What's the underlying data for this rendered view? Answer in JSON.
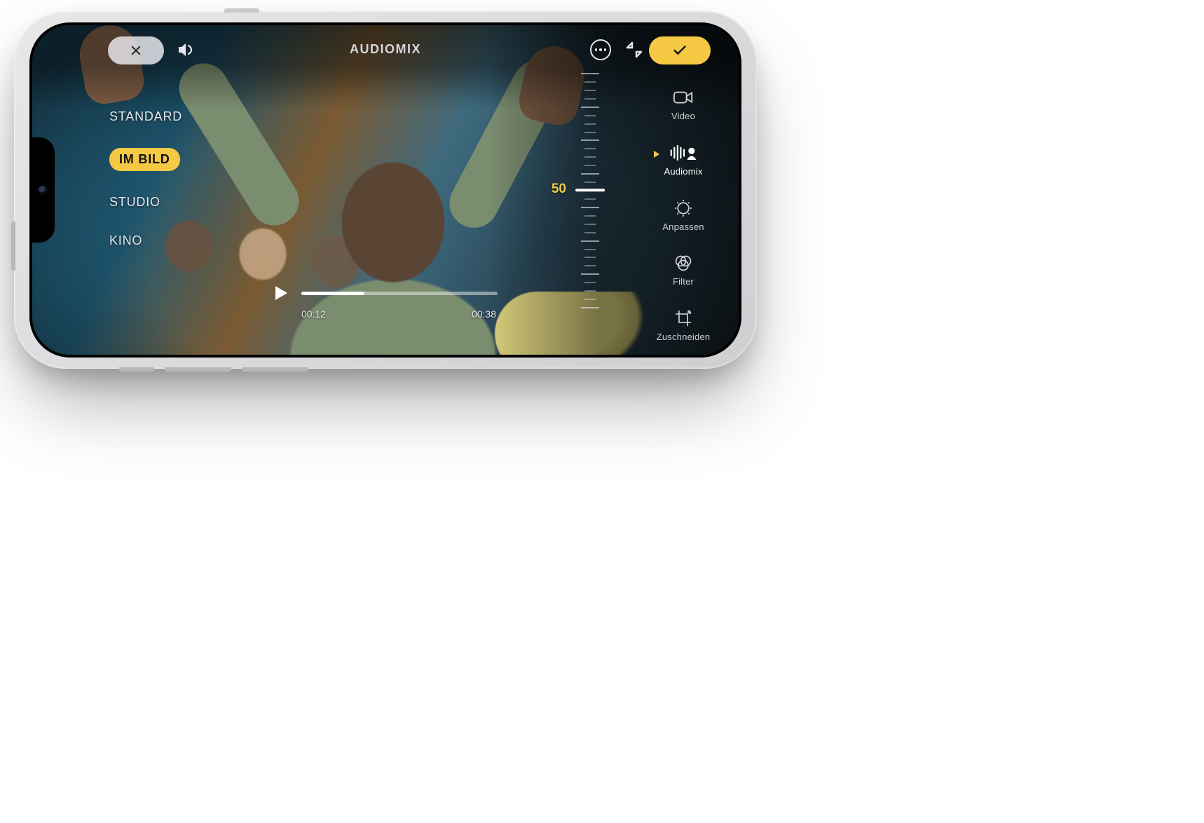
{
  "header": {
    "title": "AUDIOMIX"
  },
  "modes": {
    "items": [
      {
        "label": "STANDARD",
        "active": false
      },
      {
        "label": "IM BILD",
        "active": true
      },
      {
        "label": "STUDIO",
        "active": false
      },
      {
        "label": "KINO",
        "active": false
      }
    ]
  },
  "playback": {
    "current": "00:12",
    "duration": "00:38",
    "progress_pct": 32
  },
  "slider": {
    "value": 50,
    "min": 0,
    "max": 100
  },
  "tools": {
    "items": [
      {
        "key": "video",
        "label": "Video",
        "icon": "video-icon",
        "active": false
      },
      {
        "key": "audiomix",
        "label": "Audiomix",
        "icon": "audiomix-icon",
        "active": true
      },
      {
        "key": "adjust",
        "label": "Anpassen",
        "icon": "adjust-icon",
        "active": false
      },
      {
        "key": "filter",
        "label": "Filter",
        "icon": "filter-icon",
        "active": false
      },
      {
        "key": "crop",
        "label": "Zuschneiden",
        "icon": "crop-icon",
        "active": false
      }
    ]
  },
  "colors": {
    "accent": "#f6c945"
  }
}
